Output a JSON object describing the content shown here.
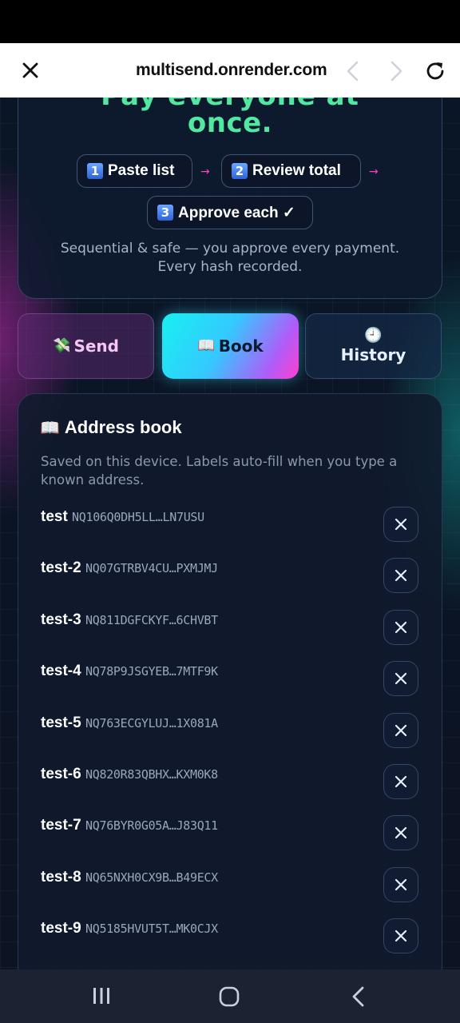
{
  "browser": {
    "url": "multisend.onrender.com"
  },
  "hero": {
    "title_cut": "Pay everyone at",
    "title": "once.",
    "steps": [
      {
        "num": "1",
        "label": "Paste list"
      },
      {
        "num": "2",
        "label": "Review total"
      },
      {
        "num": "3",
        "label": "Approve each ✓"
      }
    ],
    "arrow": "→",
    "subtitle_line1": "Sequential & safe — you approve every payment.",
    "subtitle_line2": "Every hash recorded."
  },
  "tabs": {
    "send": {
      "icon": "💸",
      "label": "Send"
    },
    "book": {
      "icon": "📖",
      "label": "Book"
    },
    "history": {
      "icon": "🕘",
      "label": "History"
    }
  },
  "address_book": {
    "icon": "📖",
    "title": "Address book",
    "description": "Saved on this device. Labels auto-fill when you type a known address.",
    "entries": [
      {
        "label": "test",
        "address": "NQ106Q0DH5LL…LN7USU"
      },
      {
        "label": "test-2",
        "address": "NQ07GTRBV4CU…PXMJMJ"
      },
      {
        "label": "test-3",
        "address": "NQ811DGFCKYF…6CHVBT"
      },
      {
        "label": "test-4",
        "address": "NQ78P9JSGYEB…7MTF9K"
      },
      {
        "label": "test-5",
        "address": "NQ763ECGYLUJ…1X081A"
      },
      {
        "label": "test-6",
        "address": "NQ820R83QBHX…KXM0K8"
      },
      {
        "label": "test-7",
        "address": "NQ76BYR0G05A…J83Q11"
      },
      {
        "label": "test-8",
        "address": "NQ65NXH0CX9B…B49ECX"
      },
      {
        "label": "test-9",
        "address": "NQ5185HVUT5T…MK0CJX"
      }
    ]
  },
  "colors": {
    "accent_green": "#53e8a2",
    "accent_pink": "#ff3fc4",
    "accent_cyan": "#18f0f0"
  }
}
